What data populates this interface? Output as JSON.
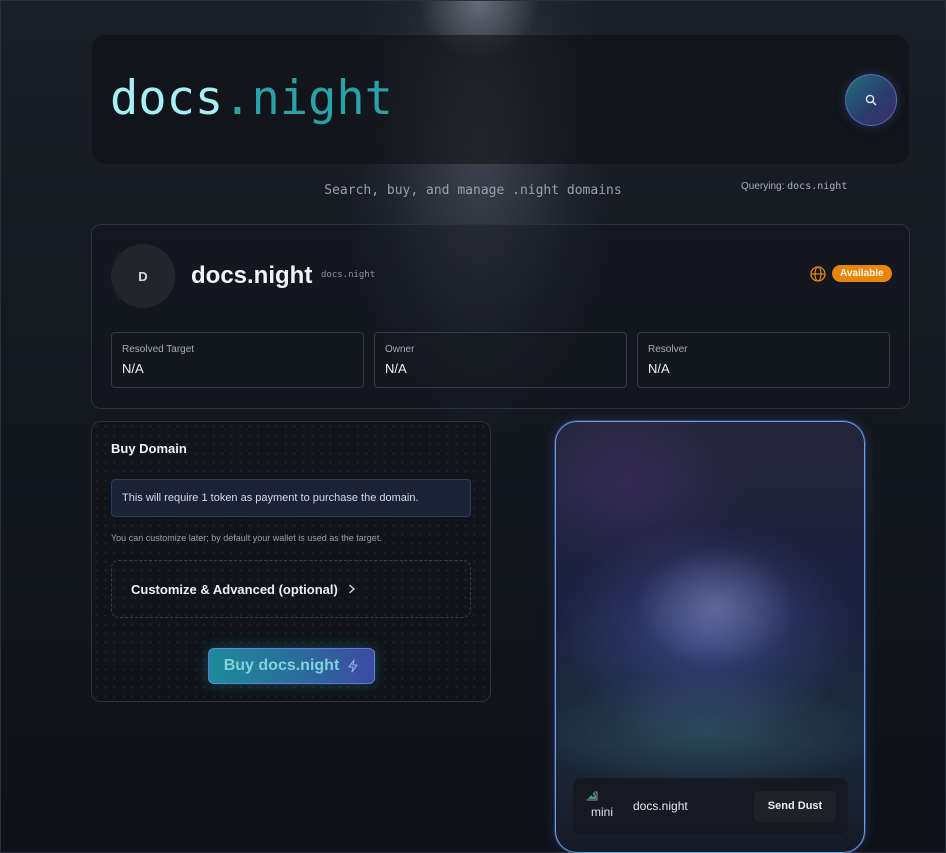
{
  "header": {
    "logo_main": "docs",
    "logo_accent": ".night",
    "search_icon": "search-icon"
  },
  "tagline": "Search, buy, and manage .night domains",
  "querying": {
    "label": "Querying:",
    "value": "docs.night"
  },
  "domain": {
    "avatar_letter": "D",
    "name": "docs.night",
    "name_small": "docs.night",
    "status_icon": "globe-icon",
    "status_badge": "Available",
    "status_color": "#e8860c",
    "fields": [
      {
        "label": "Resolved Target",
        "value": "N/A"
      },
      {
        "label": "Owner",
        "value": "N/A"
      },
      {
        "label": "Resolver",
        "value": "N/A"
      }
    ]
  },
  "buy": {
    "title": "Buy Domain",
    "notice": "This will require 1 token as payment to purchase the domain.",
    "hint": "You can customize later; by default your wallet is used as the target.",
    "customize_label": "Customize & Advanced (optional)",
    "customize_icon": "chevron-right-icon",
    "button_label": "Buy docs.night",
    "button_icon": "bolt-icon"
  },
  "card": {
    "image_alt": "mini",
    "name": "docs.night",
    "send_button": "Send Dust"
  },
  "colors": {
    "accent_cyan": "#2aa0a8",
    "logo_light": "#a8eef6",
    "card_border": "#5aa8e6"
  }
}
